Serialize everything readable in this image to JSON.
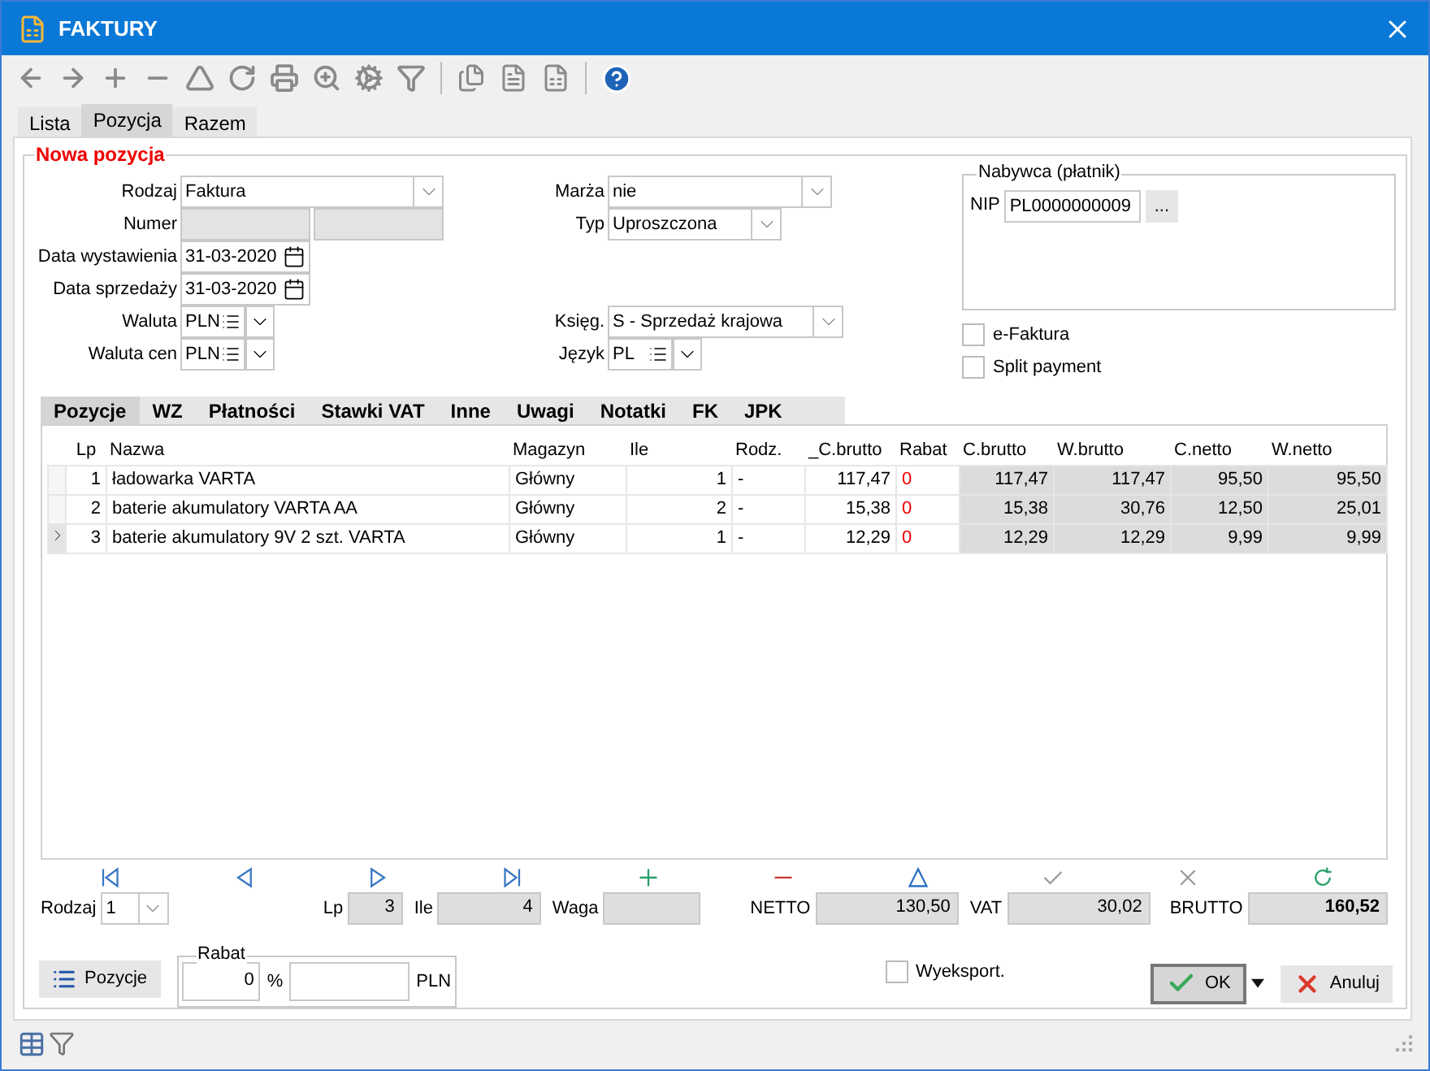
{
  "window": {
    "title": "FAKTURY"
  },
  "tabs": [
    {
      "label": "Lista",
      "selected": false
    },
    {
      "label": "Pozycja",
      "selected": true
    },
    {
      "label": "Razem",
      "selected": false
    }
  ],
  "form": {
    "title": "Nowa pozycja",
    "rows": [
      {
        "left": {
          "kind": "combo",
          "label": "Rodzaj",
          "value": "Faktura"
        },
        "middle": {
          "kind": "combo",
          "label": "Marża",
          "value": "nie"
        }
      },
      {
        "left": {
          "kind": "pair",
          "label": "Numer"
        },
        "middle": {
          "kind": "combo",
          "label": "Typ",
          "value": "Uproszczona"
        }
      },
      {
        "left": {
          "kind": "date",
          "label": "Data wystawienia",
          "value": "31-03-2020"
        }
      },
      {
        "left": {
          "kind": "date",
          "label": "Data sprzedaży",
          "value": "31-03-2020"
        }
      },
      {
        "left": {
          "kind": "list",
          "label": "Waluta",
          "value": "PLN"
        },
        "middle": {
          "kind": "combo",
          "label": "Księg.",
          "value": "S - Sprzedaż krajowa"
        }
      },
      {
        "left": {
          "kind": "list",
          "label": "Waluta cen",
          "value": "PLN"
        },
        "middle": {
          "kind": "list",
          "label": "Język",
          "value": "PL"
        }
      }
    ],
    "buyer": {
      "title": "Nabywca (płatnik)",
      "nip_label": "NIP",
      "nip_value": "PL0000000009",
      "browse": "..."
    },
    "checkboxes": [
      {
        "label": "e-Faktura",
        "checked": false
      },
      {
        "label": "Split payment",
        "checked": false
      }
    ]
  },
  "inner_tabs": [
    {
      "label": "Pozycje",
      "selected": true
    },
    {
      "label": "WZ",
      "selected": false
    },
    {
      "label": "Płatności",
      "selected": false
    },
    {
      "label": "Stawki VAT",
      "selected": false
    },
    {
      "label": "Inne",
      "selected": false
    },
    {
      "label": "Uwagi",
      "selected": false
    },
    {
      "label": "Notatki",
      "selected": false
    },
    {
      "label": "FK",
      "selected": false
    },
    {
      "label": "JPK",
      "selected": false
    }
  ],
  "table": {
    "columns": [
      "Lp",
      "Nazwa",
      "Magazyn",
      "Ile",
      "Rodz.",
      "_C.brutto",
      "Rabat",
      "C.brutto",
      "W.brutto",
      "C.netto",
      "W.netto"
    ],
    "rows": [
      {
        "current": false,
        "cells": [
          "1",
          "ładowarka VARTA",
          "Główny",
          "1",
          "-",
          "117,47",
          "0",
          "117,47",
          "117,47",
          "95,50",
          "95,50"
        ]
      },
      {
        "current": false,
        "cells": [
          "2",
          "baterie akumulatory VARTA AA",
          "Główny",
          "2",
          "-",
          "15,38",
          "0",
          "15,38",
          "30,76",
          "12,50",
          "25,01"
        ]
      },
      {
        "current": true,
        "cells": [
          "3",
          "baterie akumulatory 9V 2 szt. VARTA",
          "Główny",
          "1",
          "-",
          "12,29",
          "0",
          "12,29",
          "12,29",
          "9,99",
          "9,99"
        ]
      }
    ]
  },
  "summary": {
    "rodzaj": {
      "label": "Rodzaj",
      "value": "1"
    },
    "lp": {
      "label": "Lp",
      "value": "3"
    },
    "ile": {
      "label": "Ile",
      "value": "4"
    },
    "waga": {
      "label": "Waga"
    },
    "netto": {
      "label": "NETTO",
      "value": "130,50"
    },
    "vat": {
      "label": "VAT",
      "value": "30,02"
    },
    "brutto": {
      "label": "BRUTTO",
      "value": "160,52"
    }
  },
  "bottom": {
    "pozycje_button": "Pozycje",
    "rabat": {
      "title": "Rabat",
      "percent_value": "0",
      "percent_unit": "%",
      "amount_unit": "PLN"
    },
    "export": {
      "label": "Wyeksport.",
      "checked": false
    },
    "ok_button": "OK",
    "cancel_button": "Anuluj"
  }
}
